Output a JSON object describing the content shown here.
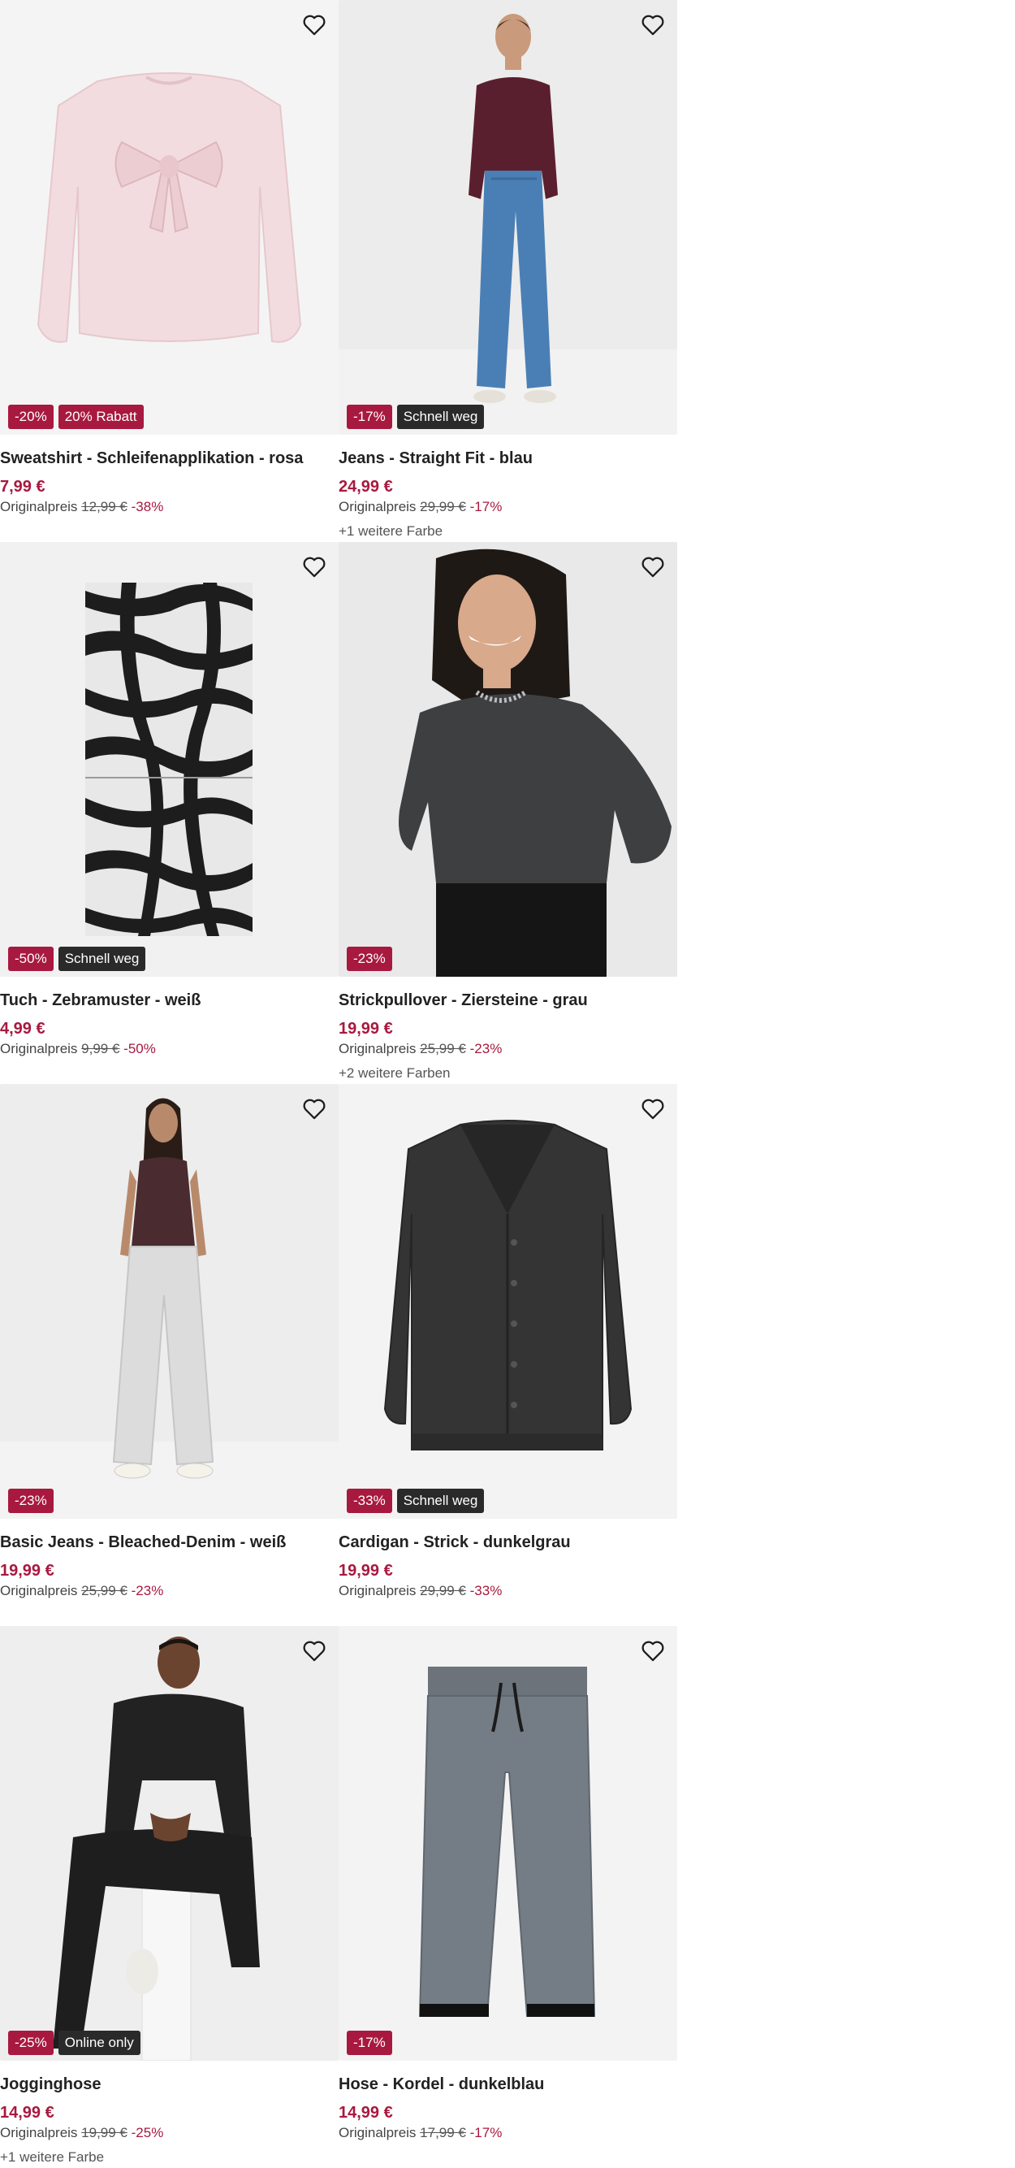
{
  "products": [
    {
      "title": "Sweatshirt - Schleifenapplikation - rosa",
      "price": "7,99 €",
      "orig_label": "Originalpreis",
      "orig_price": "12,99 €",
      "orig_pct": "-38%",
      "badges": [
        {
          "text": "-20%",
          "style": "red"
        },
        {
          "text": "20% Rabatt",
          "style": "red"
        }
      ],
      "more_colors": ""
    },
    {
      "title": "Jeans - Straight Fit - blau",
      "price": "24,99 €",
      "orig_label": "Originalpreis",
      "orig_price": "29,99 €",
      "orig_pct": "-17%",
      "badges": [
        {
          "text": "-17%",
          "style": "red"
        },
        {
          "text": "Schnell weg",
          "style": "dark"
        }
      ],
      "more_colors": "+1 weitere Farbe"
    },
    {
      "title": "Tuch - Zebramuster - weiß",
      "price": "4,99 €",
      "orig_label": "Originalpreis",
      "orig_price": "9,99 €",
      "orig_pct": "-50%",
      "badges": [
        {
          "text": "-50%",
          "style": "red"
        },
        {
          "text": "Schnell weg",
          "style": "dark"
        }
      ],
      "more_colors": ""
    },
    {
      "title": "Strickpullover - Ziersteine - grau",
      "price": "19,99 €",
      "orig_label": "Originalpreis",
      "orig_price": "25,99 €",
      "orig_pct": "-23%",
      "badges": [
        {
          "text": "-23%",
          "style": "red"
        }
      ],
      "more_colors": "+2 weitere Farben"
    },
    {
      "title": "Basic Jeans - Bleached-Denim - weiß",
      "price": "19,99 €",
      "orig_label": "Originalpreis",
      "orig_price": "25,99 €",
      "orig_pct": "-23%",
      "badges": [
        {
          "text": "-23%",
          "style": "red"
        }
      ],
      "more_colors": ""
    },
    {
      "title": "Cardigan - Strick - dunkelgrau",
      "price": "19,99 €",
      "orig_label": "Originalpreis",
      "orig_price": "29,99 €",
      "orig_pct": "-33%",
      "badges": [
        {
          "text": "-33%",
          "style": "red"
        },
        {
          "text": "Schnell weg",
          "style": "dark"
        }
      ],
      "more_colors": ""
    },
    {
      "title": "Jogginghose",
      "price": "14,99 €",
      "orig_label": "Originalpreis",
      "orig_price": "19,99 €",
      "orig_pct": "-25%",
      "badges": [
        {
          "text": "-25%",
          "style": "red"
        },
        {
          "text": "Online only",
          "style": "dark"
        }
      ],
      "more_colors": "+1 weitere Farbe"
    },
    {
      "title": "Hose - Kordel - dunkelblau",
      "price": "14,99 €",
      "orig_label": "Originalpreis",
      "orig_price": "17,99 €",
      "orig_pct": "-17%",
      "badges": [
        {
          "text": "-17%",
          "style": "red"
        }
      ],
      "more_colors": ""
    }
  ],
  "icons": {
    "favorite": "heart-outline-icon"
  },
  "colors": {
    "accent": "#a8193f",
    "dark_badge": "#2a2a2a",
    "image_bg": "#f0f0f0"
  }
}
